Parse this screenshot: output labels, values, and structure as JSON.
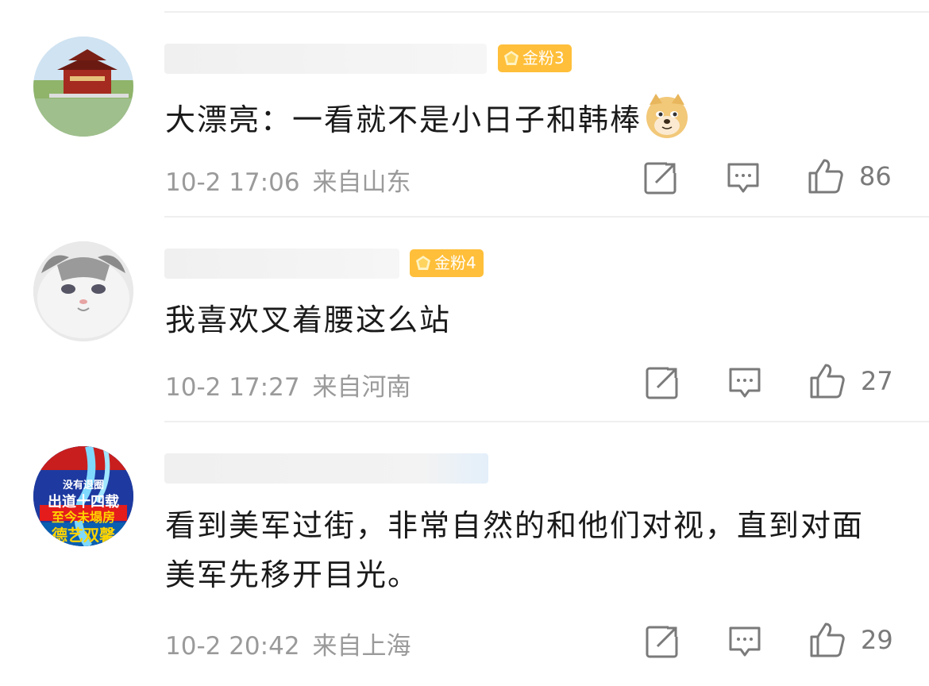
{
  "comments": [
    {
      "badge": "金粉3",
      "text": "大漂亮：一看就不是小日子和韩棒",
      "emoji": "doge-emoji",
      "time": "10-2 17:06",
      "location": "来自山东",
      "likes": "86",
      "avatar": "pavilion-lake-photo"
    },
    {
      "badge": "金粉4",
      "text": "我喜欢叉着腰这么站",
      "time": "10-2 17:27",
      "location": "来自河南",
      "likes": "27",
      "avatar": "gray-white-cat-photo"
    },
    {
      "badge": "",
      "text": "看到美军过街，非常自然的和他们对视，直到对面美军先移开目光。",
      "time": "10-2 20:42",
      "location": "来自上海",
      "likes": "29",
      "avatar": "poster-image",
      "avatar_lines": [
        "没有退圈",
        "出道十四载",
        "至今未塌房",
        "德艺双馨"
      ]
    }
  ],
  "icons": {
    "repost": "repost-icon",
    "comment": "comment-icon",
    "like": "like-icon",
    "badge": "diamond-badge-icon"
  },
  "colors": {
    "badge_bg": "#ffbf3a",
    "meta_text": "#9a9a9a",
    "body_text": "#1a1a1a"
  }
}
